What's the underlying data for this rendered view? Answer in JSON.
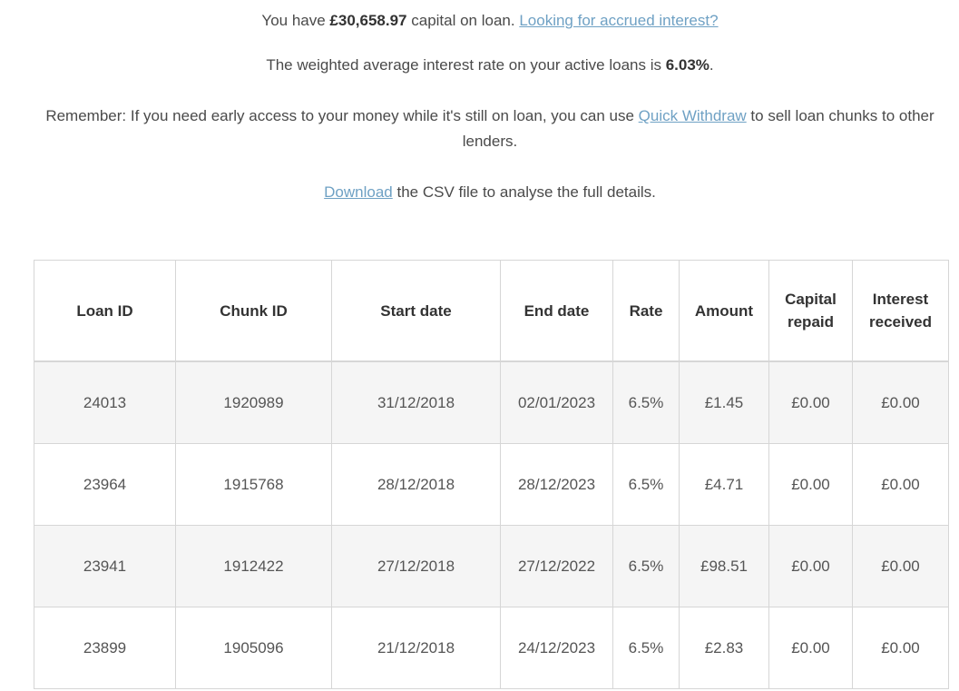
{
  "summary": {
    "capital_prefix": "You have ",
    "capital_amount": "£30,658.97",
    "capital_suffix": " capital on loan. ",
    "accrued_link": "Looking for accrued interest?",
    "rate_prefix": "The weighted average interest rate on your active loans is ",
    "rate_value": "6.03%",
    "rate_suffix": ".",
    "reminder_prefix": "Remember: If you need early access to your money while it's still on loan, you can use ",
    "quick_withdraw_link": "Quick Withdraw",
    "reminder_suffix": " to sell loan chunks to other lenders.",
    "download_link": "Download",
    "download_suffix": " the CSV file to analyse the full details."
  },
  "table": {
    "headers": [
      "Loan ID",
      "Chunk ID",
      "Start date",
      "End date",
      "Rate",
      "Amount",
      "Capital repaid",
      "Interest received"
    ],
    "rows": [
      [
        "24013",
        "1920989",
        "31/12/2018",
        "02/01/2023",
        "6.5%",
        "£1.45",
        "£0.00",
        "£0.00"
      ],
      [
        "23964",
        "1915768",
        "28/12/2018",
        "28/12/2023",
        "6.5%",
        "£4.71",
        "£0.00",
        "£0.00"
      ],
      [
        "23941",
        "1912422",
        "27/12/2018",
        "27/12/2022",
        "6.5%",
        "£98.51",
        "£0.00",
        "£0.00"
      ],
      [
        "23899",
        "1905096",
        "21/12/2018",
        "24/12/2023",
        "6.5%",
        "£2.83",
        "£0.00",
        "£0.00"
      ]
    ]
  },
  "colors": {
    "link": "#6fa1c4",
    "text": "#4a4a4a",
    "row_alt": "#f5f5f5",
    "border": "#d6d6d6"
  }
}
